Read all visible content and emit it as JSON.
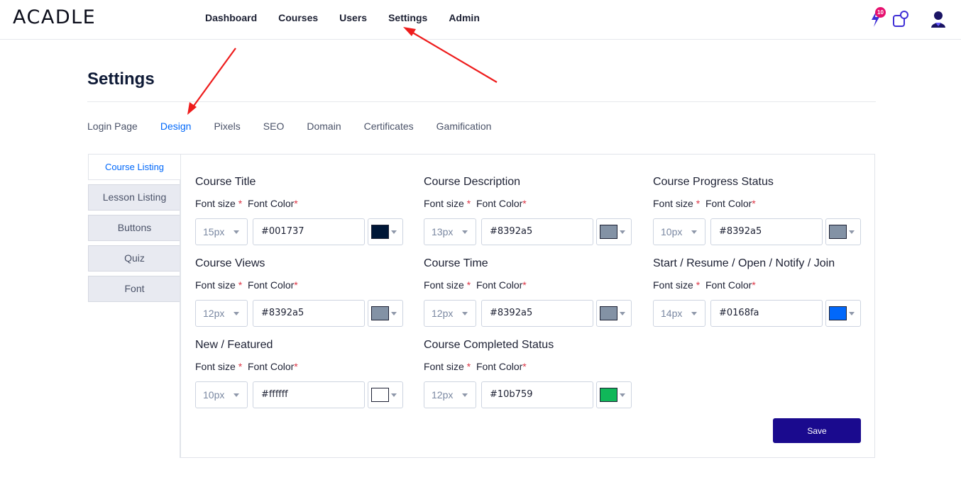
{
  "app": {
    "logo": "ACADLE",
    "nav": [
      "Dashboard",
      "Courses",
      "Users",
      "Settings",
      "Admin"
    ],
    "notifications_count": "10"
  },
  "page": {
    "title": "Settings",
    "tabs": [
      "Login Page",
      "Design",
      "Pixels",
      "SEO",
      "Domain",
      "Certificates",
      "Gamification"
    ],
    "active_tab": "Design"
  },
  "sidebar": {
    "items": [
      "Course Listing",
      "Lesson Listing",
      "Buttons",
      "Quiz",
      "Font"
    ],
    "active": "Course Listing"
  },
  "labels": {
    "font_size": "Font size",
    "font_color": "Font Color",
    "required": "*"
  },
  "groups": [
    {
      "title": "Course Title",
      "size": "15px",
      "color": "#001737"
    },
    {
      "title": "Course Description",
      "size": "13px",
      "color": "#8392a5"
    },
    {
      "title": "Course Progress Status",
      "size": "10px",
      "color": "#8392a5"
    },
    {
      "title": "Course Views",
      "size": "12px",
      "color": "#8392a5"
    },
    {
      "title": "Course Time",
      "size": "12px",
      "color": "#8392a5"
    },
    {
      "title": "Start / Resume / Open / Notify / Join",
      "size": "14px",
      "color": "#0168fa"
    },
    {
      "title": "New / Featured",
      "size": "10px",
      "color": "#ffffff"
    },
    {
      "title": "Course Completed Status",
      "size": "12px",
      "color": "#10b759"
    }
  ],
  "save_label": "Save",
  "colors": {
    "accent": "#0168fa",
    "save_button": "#1a0a8e",
    "badge": "#e6106e",
    "annotation_arrow": "#ee1c1c"
  },
  "icons": [
    "bolt-icon",
    "shapes-icon",
    "user-icon",
    "chevron-down-icon"
  ]
}
